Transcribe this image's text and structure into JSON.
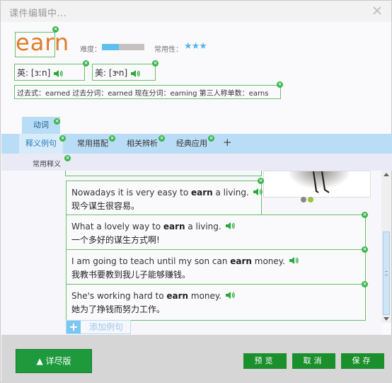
{
  "window": {
    "title": "课件编辑中..."
  },
  "word": {
    "text": "earn",
    "difficulty_label": "难度：",
    "difficulty_level": 0.4,
    "frequency_label": "常用性：",
    "frequency_stars": "★★★"
  },
  "phonetics": {
    "uk": "英: [ɜːn]",
    "us": "美: [ɝn]"
  },
  "forms": "过去式：earned 过去分词：earned 现在分词：earning 第三人称单数：earns",
  "pos_tab": "动词",
  "tabs": [
    "释义例句",
    "常用搭配",
    "相关辨析",
    "经典应用"
  ],
  "sub_tab": "常用释义",
  "examples": [
    {
      "en_pre": "Nowadays it is very easy to ",
      "en_bold": "earn",
      "en_post": " a living.",
      "zh": "现今谋生很容易。"
    },
    {
      "en_pre": "What a lovely way to ",
      "en_bold": "earn",
      "en_post": " a living.",
      "zh": "一个多好的谋生方式啊!"
    },
    {
      "en_pre": "I am going to teach until my son can ",
      "en_bold": "earn",
      "en_post": " money.",
      "zh": "我教书要教到我儿子能够赚钱。"
    },
    {
      "en_pre": "She's working hard to ",
      "en_bold": "earn",
      "en_post": " money.",
      "zh": "她为了挣钱而努力工作。"
    }
  ],
  "add_example": "添加例句",
  "buttons": {
    "detail": "▲ 详尽版",
    "preview": "预览",
    "cancel": "取消",
    "save": "保存"
  },
  "colors": {
    "accent_green": "#1e9a3c",
    "tab_blue": "#b9ddf6",
    "word_orange": "#e07b2a"
  }
}
